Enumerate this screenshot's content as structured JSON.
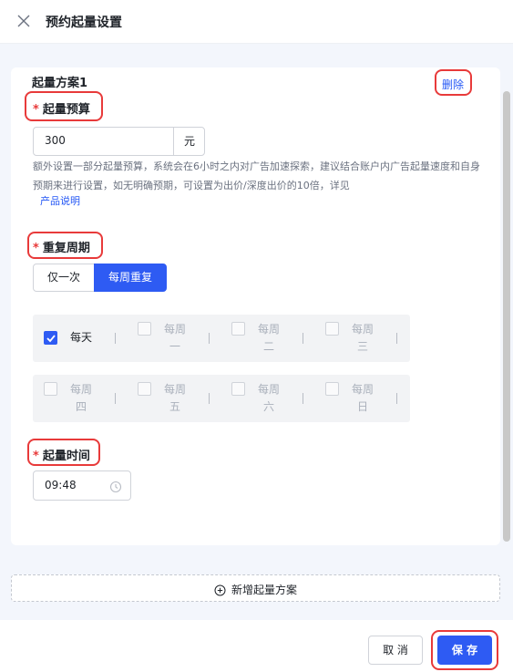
{
  "header": {
    "title": "预约起量设置",
    "close_icon": "close-icon"
  },
  "plan": {
    "title": "起量方案1",
    "delete_label": "删除"
  },
  "budget": {
    "required_mark": "*",
    "label": "起量预算",
    "value": "300",
    "unit": "元",
    "help_text": "额外设置一部分起量预算，系统会在6小时之内对广告加速探索，建议结合账户内广告起量速度和自身预期来进行设置，如无明确预期，可设置为出价/深度出价的10倍，详见",
    "help_link": "产品说明"
  },
  "repeat": {
    "required_mark": "*",
    "label": "重复周期",
    "options": [
      "仅一次",
      "每周重复"
    ],
    "selected": "每周重复",
    "days_row1": [
      {
        "label": "每天",
        "checked": true
      },
      {
        "label": "每周一",
        "checked": false
      },
      {
        "label": "每周二",
        "checked": false
      },
      {
        "label": "每周三",
        "checked": false
      }
    ],
    "days_row2": [
      {
        "label": "每周四",
        "checked": false
      },
      {
        "label": "每周五",
        "checked": false
      },
      {
        "label": "每周六",
        "checked": false
      },
      {
        "label": "每周日",
        "checked": false
      }
    ]
  },
  "time": {
    "required_mark": "*",
    "label": "起量时间",
    "value": "09:48",
    "icon": "clock-icon"
  },
  "add_plan": {
    "label": "新增起量方案",
    "icon": "plus-circle-icon"
  },
  "footer": {
    "cancel_label": "取 消",
    "save_label": "保 存"
  },
  "colors": {
    "primary": "#2e5bf3",
    "highlight": "#e83a3a",
    "background": "#f3f6fc"
  }
}
